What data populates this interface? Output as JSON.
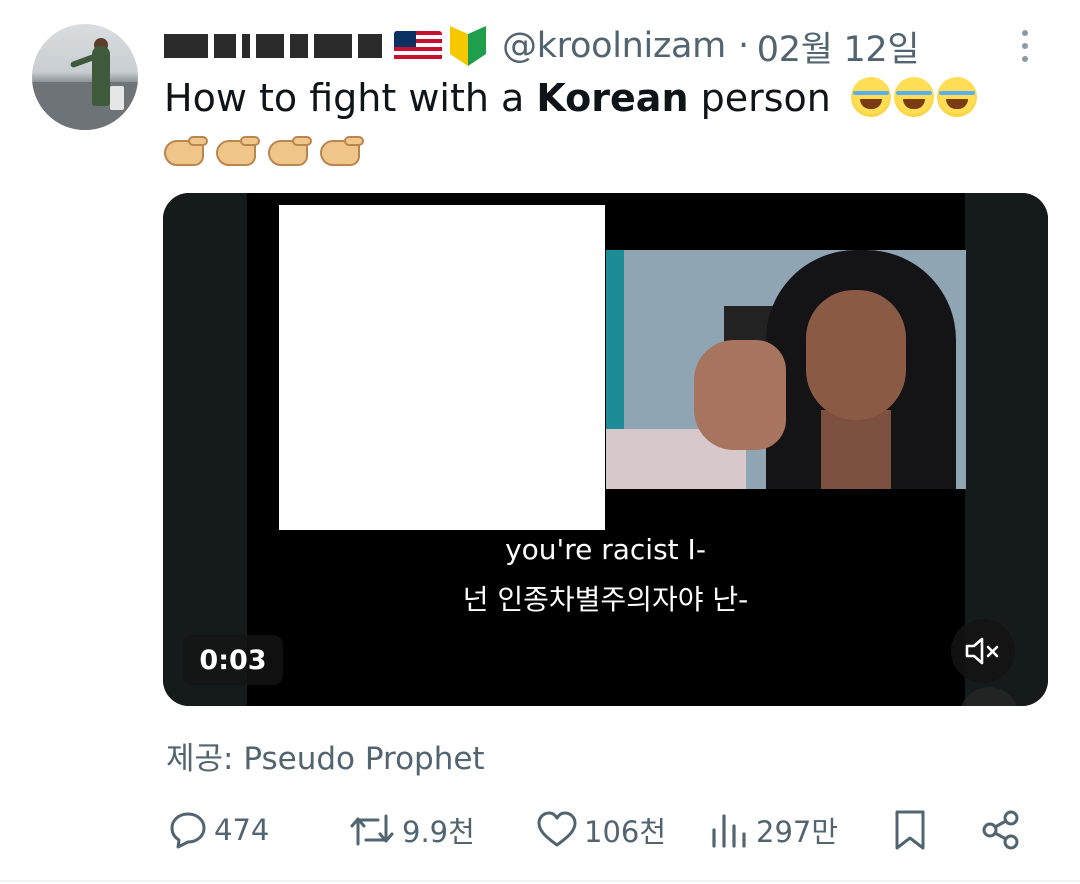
{
  "author": {
    "handle": "@kroolnizam",
    "separator": "·",
    "date": "02월 12일"
  },
  "tweet": {
    "text_before": "How to fight with a ",
    "text_bold": "Korean",
    "text_after": " person"
  },
  "video": {
    "subtitle_en": "you're racist I-",
    "subtitle_ko": "넌 인종차별주의자야 난-",
    "time": "0:03"
  },
  "credit": "제공: Pseudo Prophet",
  "actions": {
    "replies": "474",
    "reposts": "9.9천",
    "likes": "106천",
    "views": "297만"
  },
  "colors": {
    "text": "#0f1419",
    "secondary": "#536471"
  },
  "icons": [
    "more-icon",
    "flag-icon",
    "beginner-badge-icon",
    "laughing-emoji-icon",
    "pinching-hand-emoji-icon",
    "mute-icon",
    "reply-icon",
    "repost-icon",
    "like-icon",
    "views-icon",
    "bookmark-icon",
    "share-icon"
  ]
}
